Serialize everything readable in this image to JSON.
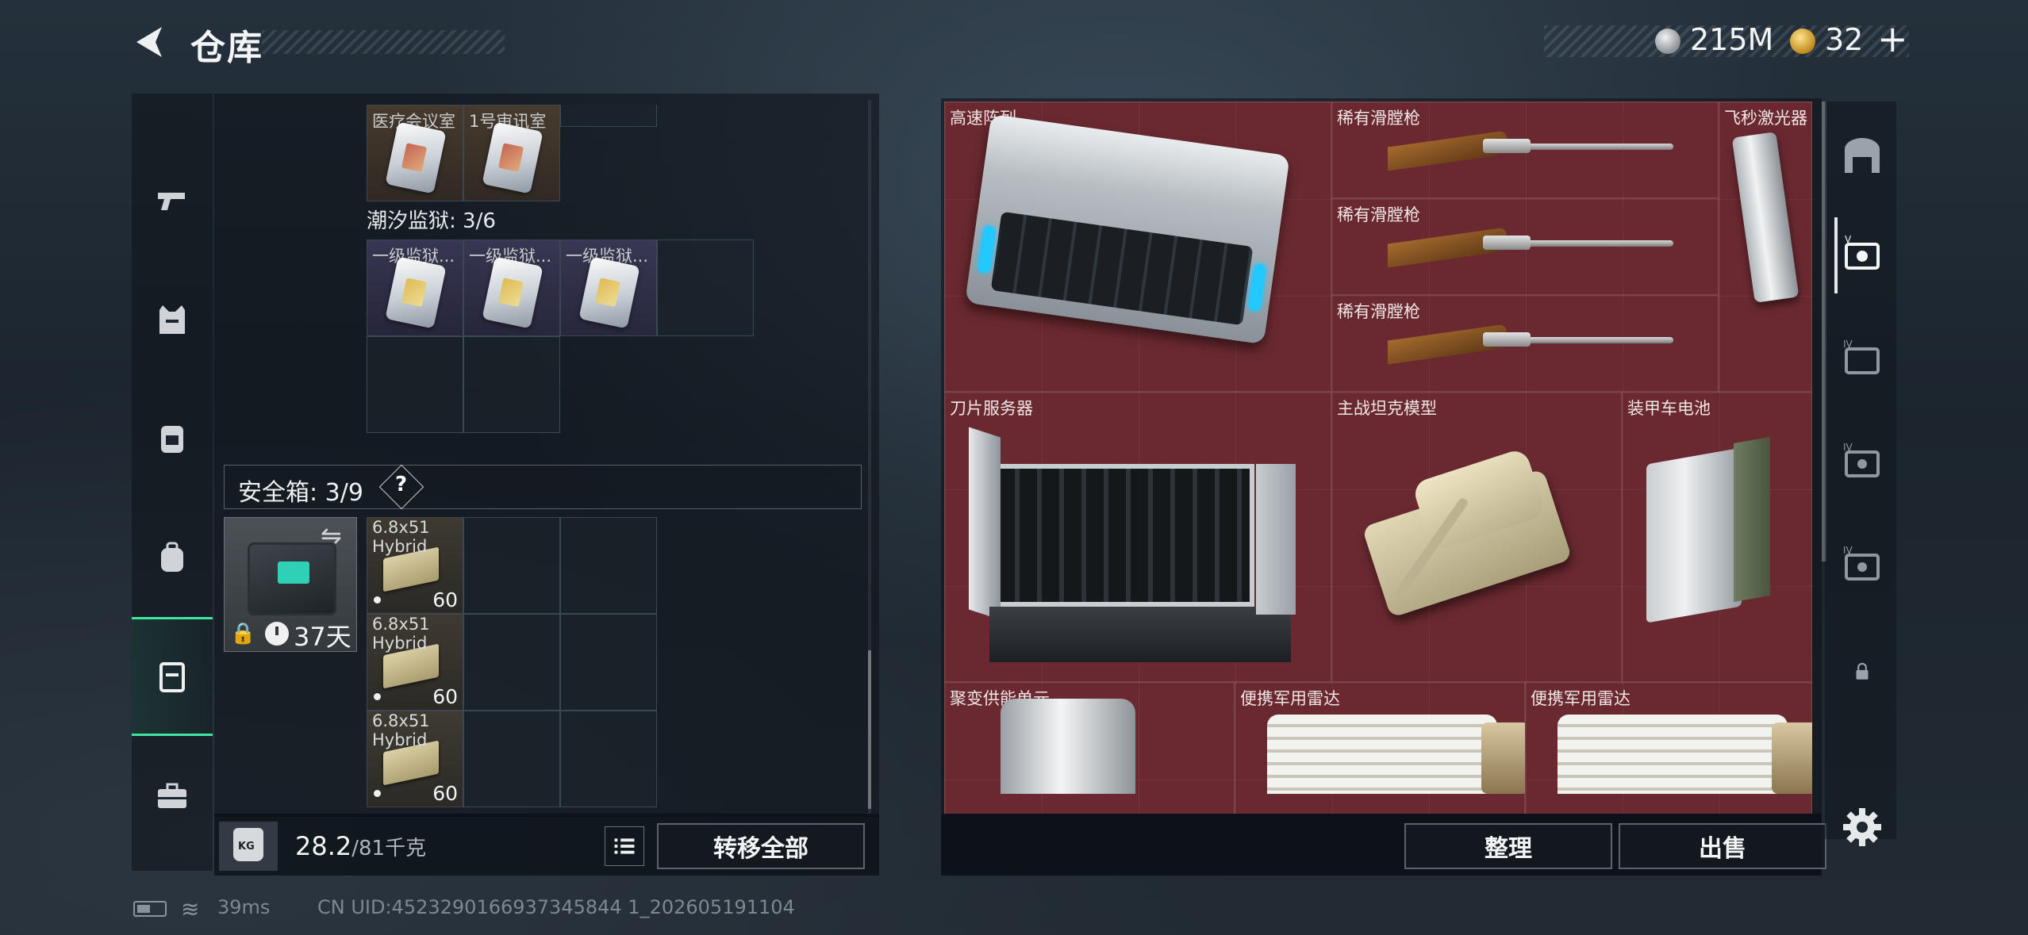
{
  "header": {
    "title": "仓库",
    "coins": "215M",
    "tickets": "32",
    "add_label": "+"
  },
  "left_categories": [
    {
      "name": "weapons",
      "icon": "pistol-icon"
    },
    {
      "name": "armor-vest",
      "icon": "vest-icon"
    },
    {
      "name": "chest-rig",
      "icon": "rig-icon"
    },
    {
      "name": "backpack",
      "icon": "backpack-icon"
    },
    {
      "name": "safe-case",
      "icon": "case-icon",
      "active": true
    },
    {
      "name": "toolbox",
      "icon": "toolbox-icon"
    }
  ],
  "keycards": {
    "row1": [
      {
        "label": "医疗会议室",
        "rarity": "orange"
      },
      {
        "label": "1号审讯室",
        "rarity": "orange"
      }
    ],
    "prison_title": "潮汐监狱: 3/6",
    "row2": [
      {
        "label": "一级监狱...",
        "rarity": "purple"
      },
      {
        "label": "一级监狱...",
        "rarity": "purple"
      },
      {
        "label": "一级监狱...",
        "rarity": "purple"
      }
    ]
  },
  "safebox": {
    "label": "安全箱: 3/9",
    "help": "?",
    "days_left": "37天",
    "ammo": [
      {
        "name_line1": "6.8x51",
        "name_line2": "Hybrid",
        "count": "60"
      },
      {
        "name_line1": "6.8x51",
        "name_line2": "Hybrid",
        "count": "60"
      },
      {
        "name_line1": "6.8x51",
        "name_line2": "Hybrid",
        "count": "60"
      }
    ]
  },
  "left_footer": {
    "weight_icon_label": "KG",
    "weight_current": "28.2",
    "weight_capacity": "/81千克",
    "transfer_all": "转移全部"
  },
  "stash_items": [
    {
      "label": "高速阵列"
    },
    {
      "label": "稀有滑膛枪"
    },
    {
      "label": "稀有滑膛枪"
    },
    {
      "label": "稀有滑膛枪"
    },
    {
      "label": "飞秒激光器"
    },
    {
      "label": "刀片服务器"
    },
    {
      "label": "主战坦克模型"
    },
    {
      "label": "装甲车电池"
    },
    {
      "label": "聚变供能单元"
    },
    {
      "label": "便携军用雷达"
    },
    {
      "label": "便携军用雷达"
    }
  ],
  "right_footer": {
    "sort": "整理",
    "sell": "出售"
  },
  "stash_tabs": [
    {
      "icon": "stash-main-icon",
      "active": false
    },
    {
      "icon": "stash-tab-5-icon",
      "active": true
    },
    {
      "icon": "stash-tab-4-icon",
      "active": false
    },
    {
      "icon": "stash-tab-4b-icon",
      "active": false
    },
    {
      "icon": "stash-tab-4c-icon",
      "active": false
    },
    {
      "icon": "lock-icon",
      "active": false
    }
  ],
  "status_bar": {
    "ping": "39ms",
    "uid": "CN UID:4523290166937345844 1_202605191104"
  },
  "colors": {
    "accent": "#3ee6a0",
    "stash_bg": "#6a2930",
    "panel_bg": "#141a20"
  }
}
